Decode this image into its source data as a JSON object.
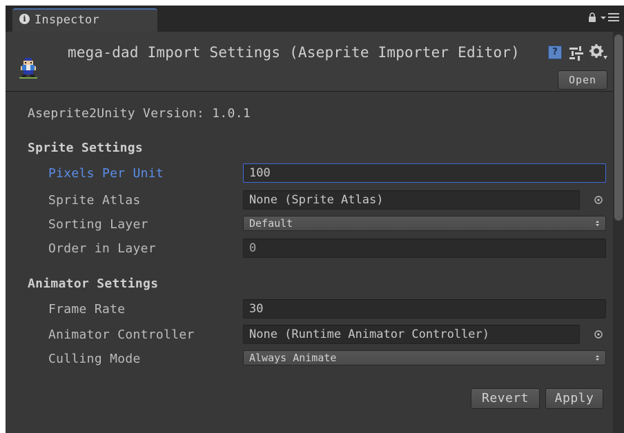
{
  "tab": {
    "title": "Inspector",
    "info_icon": "info-icon",
    "lock_icon": "lock-icon",
    "menu_icon": "tab-menu-icon"
  },
  "header": {
    "title": "mega-dad Import Settings (Aseprite Importer Editor)",
    "asset_icon": "sprite-asset-icon",
    "help_icon_glyph": "?",
    "open_label": "Open"
  },
  "version": {
    "text": "Aseprite2Unity Version: 1.0.1"
  },
  "sprite_settings": {
    "title": "Sprite Settings",
    "pixels_per_unit": {
      "label": "Pixels Per Unit",
      "value": "100"
    },
    "sprite_atlas": {
      "label": "Sprite Atlas",
      "value": "None (Sprite Atlas)"
    },
    "sorting_layer": {
      "label": "Sorting Layer",
      "value": "Default"
    },
    "order_in_layer": {
      "label": "Order in Layer",
      "value": "0"
    }
  },
  "animator_settings": {
    "title": "Animator Settings",
    "frame_rate": {
      "label": "Frame Rate",
      "value": "30"
    },
    "animator_controller": {
      "label": "Animator Controller",
      "value": "None (Runtime Animator Controller)"
    },
    "culling_mode": {
      "label": "Culling Mode",
      "value": "Always Animate"
    }
  },
  "actions": {
    "revert_label": "Revert",
    "apply_label": "Apply"
  },
  "colors": {
    "background": "#383838",
    "active_label": "#5b8de8",
    "focus_border": "#3f6ad8"
  }
}
